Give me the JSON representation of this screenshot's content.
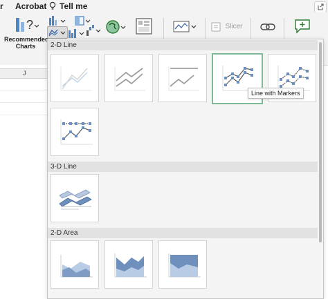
{
  "menubar": {
    "items": [
      "r",
      "Acrobat",
      "Tell me"
    ],
    "tell_me_icon": "lightbulb-icon"
  },
  "ribbon": {
    "recommended_charts": [
      "Recommended",
      "Charts"
    ],
    "slicer_label": "Slicer",
    "icons": [
      "recommended-charts-icon",
      "column-chart-icon",
      "line-chart-icon",
      "statistic-chart-icon",
      "waterfall-chart-icon",
      "map-chart-icon",
      "pivotchart-icon",
      "sparkline-icon",
      "slicer-icon",
      "link-icon",
      "comment-icon"
    ]
  },
  "sheet": {
    "column_header": "J"
  },
  "gallery": {
    "sections": [
      {
        "title": "2-D Line",
        "tiles": [
          {
            "name": "line",
            "type": "line-single"
          },
          {
            "name": "stacked-line",
            "type": "line-double"
          },
          {
            "name": "100-stacked-line",
            "type": "line-flat"
          },
          {
            "name": "line-with-markers",
            "type": "markers-double",
            "selected": true
          },
          {
            "name": "stacked-line-with-markers",
            "type": "markers-dotted"
          },
          {
            "name": "100-stacked-line-with-markers",
            "type": "markers-flat"
          }
        ]
      },
      {
        "title": "3-D Line",
        "tiles": [
          {
            "name": "3d-line",
            "type": "ribbon"
          }
        ]
      },
      {
        "title": "2-D Area",
        "tiles": [
          {
            "name": "area",
            "type": "area-overlap"
          },
          {
            "name": "stacked-area",
            "type": "area-stacked"
          },
          {
            "name": "100-stacked-area",
            "type": "area-full"
          }
        ]
      }
    ],
    "tooltip": "Line with Markers"
  }
}
